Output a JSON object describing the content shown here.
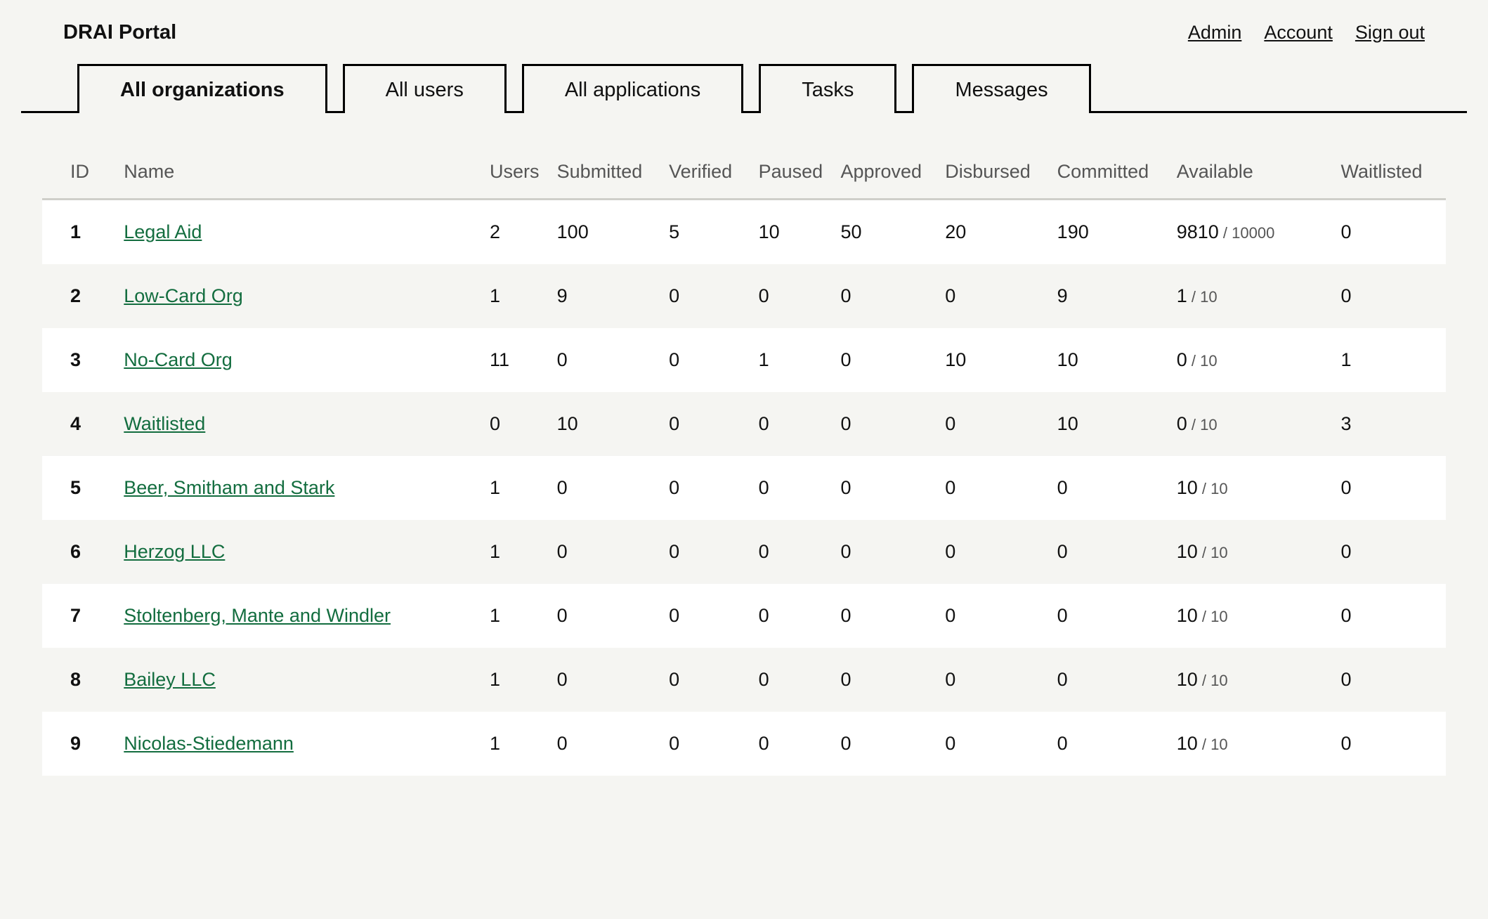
{
  "header": {
    "brand": "DRAI Portal",
    "links": [
      "Admin",
      "Account",
      "Sign out"
    ]
  },
  "tabs": [
    {
      "label": "All organizations",
      "active": true
    },
    {
      "label": "All users",
      "active": false
    },
    {
      "label": "All applications",
      "active": false
    },
    {
      "label": "Tasks",
      "active": false
    },
    {
      "label": "Messages",
      "active": false
    }
  ],
  "columns": [
    "ID",
    "Name",
    "Users",
    "Submitted",
    "Verified",
    "Paused",
    "Approved",
    "Disbursed",
    "Committed",
    "Available",
    "Waitlisted"
  ],
  "rows": [
    {
      "id": "1",
      "name": "Legal Aid",
      "users": "2",
      "submitted": "100",
      "verified": "5",
      "paused": "10",
      "approved": "50",
      "disbursed": "20",
      "committed": "190",
      "available_used": "9810",
      "available_total": "10000",
      "waitlisted": "0"
    },
    {
      "id": "2",
      "name": "Low-Card Org",
      "users": "1",
      "submitted": "9",
      "verified": "0",
      "paused": "0",
      "approved": "0",
      "disbursed": "0",
      "committed": "9",
      "available_used": "1",
      "available_total": "10",
      "waitlisted": "0"
    },
    {
      "id": "3",
      "name": "No-Card Org",
      "users": "11",
      "submitted": "0",
      "verified": "0",
      "paused": "1",
      "approved": "0",
      "disbursed": "10",
      "committed": "10",
      "available_used": "0",
      "available_total": "10",
      "waitlisted": "1"
    },
    {
      "id": "4",
      "name": "Waitlisted",
      "users": "0",
      "submitted": "10",
      "verified": "0",
      "paused": "0",
      "approved": "0",
      "disbursed": "0",
      "committed": "10",
      "available_used": "0",
      "available_total": "10",
      "waitlisted": "3"
    },
    {
      "id": "5",
      "name": "Beer, Smitham and Stark",
      "users": "1",
      "submitted": "0",
      "verified": "0",
      "paused": "0",
      "approved": "0",
      "disbursed": "0",
      "committed": "0",
      "available_used": "10",
      "available_total": "10",
      "waitlisted": "0"
    },
    {
      "id": "6",
      "name": "Herzog LLC",
      "users": "1",
      "submitted": "0",
      "verified": "0",
      "paused": "0",
      "approved": "0",
      "disbursed": "0",
      "committed": "0",
      "available_used": "10",
      "available_total": "10",
      "waitlisted": "0"
    },
    {
      "id": "7",
      "name": "Stoltenberg, Mante and Windler",
      "users": "1",
      "submitted": "0",
      "verified": "0",
      "paused": "0",
      "approved": "0",
      "disbursed": "0",
      "committed": "0",
      "available_used": "10",
      "available_total": "10",
      "waitlisted": "0"
    },
    {
      "id": "8",
      "name": "Bailey LLC",
      "users": "1",
      "submitted": "0",
      "verified": "0",
      "paused": "0",
      "approved": "0",
      "disbursed": "0",
      "committed": "0",
      "available_used": "10",
      "available_total": "10",
      "waitlisted": "0"
    },
    {
      "id": "9",
      "name": "Nicolas-Stiedemann",
      "users": "1",
      "submitted": "0",
      "verified": "0",
      "paused": "0",
      "approved": "0",
      "disbursed": "0",
      "committed": "0",
      "available_used": "10",
      "available_total": "10",
      "waitlisted": "0"
    }
  ]
}
